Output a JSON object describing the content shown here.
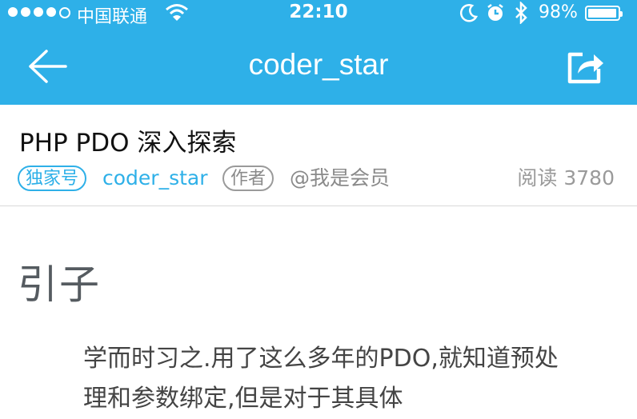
{
  "status_bar": {
    "carrier": "中国联通",
    "time": "22:10",
    "battery": "98%",
    "battery_level": 0.98,
    "icons": [
      "signal-dots",
      "wifi-icon",
      "moon-icon",
      "alarm-icon",
      "bluetooth-icon",
      "battery-icon"
    ]
  },
  "nav": {
    "title": "coder_star",
    "back_icon": "back-arrow-icon",
    "share_icon": "share-icon"
  },
  "article": {
    "title": "PHP PDO 深入探索",
    "tag_exclusive": "独家号",
    "author": "coder_star",
    "tag_author": "作者",
    "member": "@我是会员",
    "reads": "阅读 3780"
  },
  "content": {
    "heading": "引子",
    "paragraph": "学而时习之.用了这么多年的PDO,就知道预处理和参数绑定,但是对于其具体"
  },
  "colors": {
    "header_bg": "#2eb0e8",
    "accent": "#2eb0e8"
  }
}
